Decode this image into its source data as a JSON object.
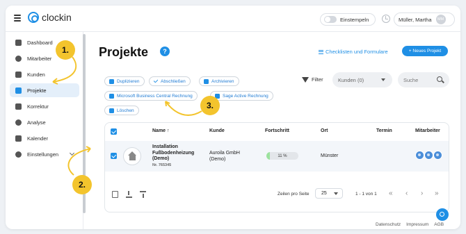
{
  "app": {
    "logo_text": "clockin"
  },
  "header": {
    "stamp_label": "Einstempeln",
    "user_name": "Müller, Martha",
    "user_initials": "MM"
  },
  "sidebar": {
    "items": [
      {
        "label": "Dashboard"
      },
      {
        "label": "Mitarbeiter"
      },
      {
        "label": "Kunden"
      },
      {
        "label": "Projekte"
      },
      {
        "label": "Korrektur"
      },
      {
        "label": "Analyse"
      },
      {
        "label": "Kalender"
      },
      {
        "label": "Einstellungen"
      }
    ],
    "active_index": 3
  },
  "main": {
    "title": "Projekte",
    "help": "?",
    "checklist_link": "Checklisten und Formulare",
    "new_button": "+ Neues Projekt",
    "actions": [
      "Duplizieren",
      "Abschließen",
      "Archivieren",
      "Microsoft Business Central Rechnung",
      "Sage Active Rechnung",
      "Löschen"
    ],
    "filter_label": "Filter",
    "customer_select": "Kunden (0)",
    "search_placeholder": "Suche"
  },
  "table": {
    "columns": [
      "Name",
      "Kunde",
      "Fortschritt",
      "Ort",
      "Termin",
      "Mitarbeiter"
    ],
    "sort_indicator": "↑",
    "rows": [
      {
        "name_line1": "Installation",
        "name_line2": "Fußbodenheizung",
        "name_line3": "(Demo)",
        "number": "Nr. 765345",
        "customer_line1": "Auroila GmbH",
        "customer_line2": "(Demo)",
        "progress_label": "11 %",
        "progress_value": 0.11,
        "location": "Münster",
        "date": "",
        "employees": 3
      }
    ],
    "pager": {
      "rows_per_page_label": "Zeilen pro Seite",
      "rows_per_page": "25",
      "range": "1 - 1 von 1",
      "first": "«",
      "prev": "‹",
      "next": "›",
      "last": "»"
    }
  },
  "footer": {
    "links": [
      "Datenschutz",
      "Impressum",
      "AGB"
    ]
  },
  "annotations": {
    "steps": [
      "1.",
      "2.",
      "3."
    ],
    "color": "#f3c42d"
  },
  "colors": {
    "accent": "#1f8fe5",
    "progress": "#9ce29e",
    "active_nav": "#e4effa"
  }
}
